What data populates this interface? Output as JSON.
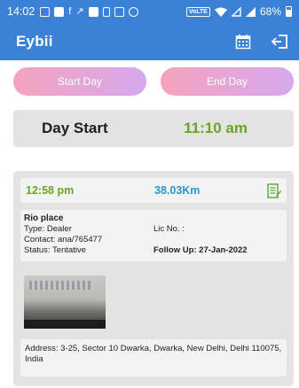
{
  "status_bar": {
    "time": "14:02",
    "volte": "VoLTE",
    "battery": "68%"
  },
  "app_bar": {
    "title": "Eybii",
    "icons": [
      "calendar-icon",
      "logout-icon"
    ]
  },
  "day_buttons": {
    "start_label": "Start Day",
    "end_label": "End Day"
  },
  "day_start": {
    "label": "Day Start",
    "time": "11:10 am"
  },
  "visit": {
    "time": "12:58 pm",
    "distance": "38.03Km",
    "name": "Rio place",
    "type": "Type: Dealer",
    "lic": "Lic No. :",
    "contact": "Contact: ana/765477",
    "status": "Status: Tentative",
    "follow_up": "Follow Up: 27-Jan-2022",
    "address": "Address: 3-25, Sector 10 Dwarka, Dwarka, New Delhi, Delhi 110075, India"
  },
  "colors": {
    "primary": "#3b82d6",
    "accent_green": "#6aa521",
    "accent_blue": "#2a97cc",
    "button_gradient_start": "#f5a3bd",
    "button_gradient_end": "#d6a8ef"
  }
}
